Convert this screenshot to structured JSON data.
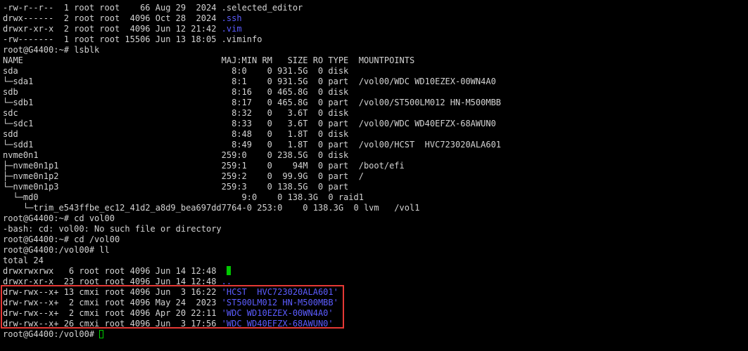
{
  "colors": {
    "background": "#000000",
    "text": "#d3d3d3",
    "dir_blue": "#5c5cff",
    "highlight_red": "#e53935",
    "cursor_green": "#00c800"
  },
  "terminal": {
    "lines": [
      {
        "text": "-rw-r--r--  1 root root    66 Aug 29  2024 ",
        "suffix": ".selected_editor",
        "suffix_color": ""
      },
      {
        "text": "drwx------  2 root root  4096 Oct 28  2024 ",
        "suffix": ".ssh",
        "suffix_color": "blue"
      },
      {
        "text": "drwxr-xr-x  2 root root  4096 Jun 12 21:42 ",
        "suffix": ".vim",
        "suffix_color": "blue"
      },
      {
        "text": "-rw-------  1 root root 15506 Jun 13 18:05 ",
        "suffix": ".viminfo",
        "suffix_color": ""
      },
      {
        "text": "root@G4400:~# lsblk",
        "suffix": "",
        "suffix_color": ""
      },
      {
        "text": "NAME                                       MAJ:MIN RM   SIZE RO TYPE  MOUNTPOINTS",
        "suffix": "",
        "suffix_color": ""
      },
      {
        "text": "sda                                          8:0    0 931.5G  0 disk",
        "suffix": "",
        "suffix_color": ""
      },
      {
        "text": "└─sda1                                       8:1    0 931.5G  0 part  /vol00/WDC WD10EZEX-00WN4A0",
        "suffix": "",
        "suffix_color": ""
      },
      {
        "text": "sdb                                          8:16   0 465.8G  0 disk",
        "suffix": "",
        "suffix_color": ""
      },
      {
        "text": "└─sdb1                                       8:17   0 465.8G  0 part  /vol00/ST500LM012 HN-M500MBB",
        "suffix": "",
        "suffix_color": ""
      },
      {
        "text": "sdc                                          8:32   0   3.6T  0 disk",
        "suffix": "",
        "suffix_color": ""
      },
      {
        "text": "└─sdc1                                       8:33   0   3.6T  0 part  /vol00/WDC WD40EFZX-68AWUN0",
        "suffix": "",
        "suffix_color": ""
      },
      {
        "text": "sdd                                          8:48   0   1.8T  0 disk",
        "suffix": "",
        "suffix_color": ""
      },
      {
        "text": "└─sdd1                                       8:49   0   1.8T  0 part  /vol00/HCST  HVC723020ALA601",
        "suffix": "",
        "suffix_color": ""
      },
      {
        "text": "nvme0n1                                    259:0    0 238.5G  0 disk",
        "suffix": "",
        "suffix_color": ""
      },
      {
        "text": "├─nvme0n1p1                                259:1    0    94M  0 part  /boot/efi",
        "suffix": "",
        "suffix_color": ""
      },
      {
        "text": "├─nvme0n1p2                                259:2    0  99.9G  0 part  /",
        "suffix": "",
        "suffix_color": ""
      },
      {
        "text": "└─nvme0n1p3                                259:3    0 138.5G  0 part",
        "suffix": "",
        "suffix_color": ""
      },
      {
        "text": "  └─md0                                        9:0    0 138.3G  0 raid1",
        "suffix": "",
        "suffix_color": ""
      },
      {
        "text": "    └─trim_e543ffbe_ec12_41d2_a8d9_bea697dd7764-0 253:0    0 138.3G  0 lvm   /vol1",
        "suffix": "",
        "suffix_color": ""
      },
      {
        "text": "root@G4400:~# cd vol00",
        "suffix": "",
        "suffix_color": ""
      },
      {
        "text": "-bash: cd: vol00: No such file or directory",
        "suffix": "",
        "suffix_color": ""
      },
      {
        "text": "root@G4400:~# cd /vol00",
        "suffix": "",
        "suffix_color": ""
      },
      {
        "text": "root@G4400:/vol00# ll",
        "suffix": "",
        "suffix_color": ""
      },
      {
        "text": "total 24",
        "suffix": "",
        "suffix_color": ""
      },
      {
        "text": "drwxrwxrwx   6 root root 4096 Jun 14 12:48  ",
        "suffix": "",
        "suffix_color": "",
        "green_block": true
      },
      {
        "text": "drwxr-xr-x  23 root root 4096 Jun 14 12:48 ",
        "suffix": "..",
        "suffix_color": "blue"
      },
      {
        "text": "drw-rwx--x+ 13 cmxi root 4096 Jun  3 16:22 ",
        "suffix": "'HCST  HVC723020ALA601'",
        "suffix_color": "blue"
      },
      {
        "text": "drw-rwx--x+  2 cmxi root 4096 May 24  2023 ",
        "suffix": "'ST500LM012 HN-M500MBB'",
        "suffix_color": "blue"
      },
      {
        "text": "drw-rwx--x+  2 cmxi root 4096 Apr 20 22:11 ",
        "suffix": "'WDC WD10EZEX-00WN4A0'",
        "suffix_color": "blue"
      },
      {
        "text": "drw-rwx--x+ 26 cmxi root 4096 Jun  3 17:56 ",
        "suffix": "'WDC WD40EFZX-68AWUN0'",
        "suffix_color": "blue"
      },
      {
        "text": "root@G4400:/vol00# ",
        "suffix": "",
        "suffix_color": "",
        "cursor": true
      }
    ]
  }
}
